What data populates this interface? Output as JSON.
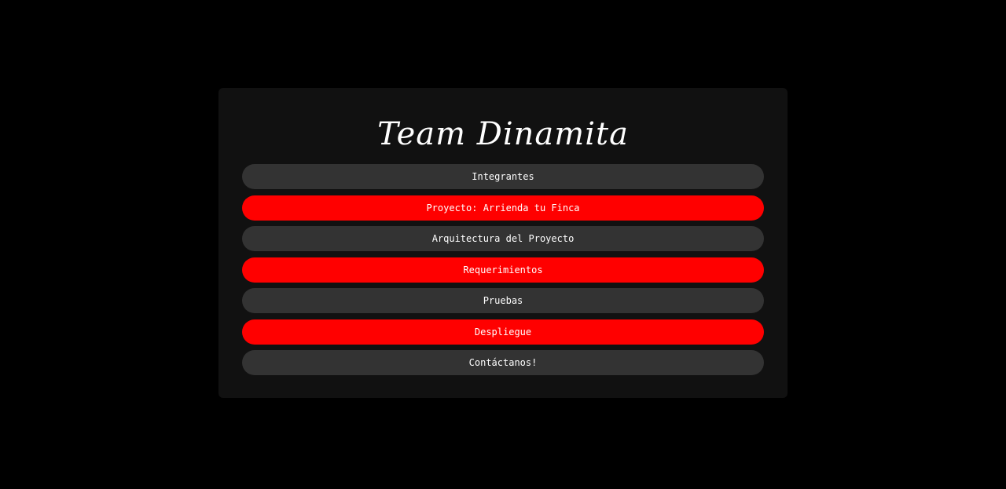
{
  "page": {
    "background_color": "#000000",
    "card_color": "#111111"
  },
  "header": {
    "title": "Team Dinamita"
  },
  "menu": {
    "colors": {
      "dark": "#333333",
      "red": "#ff0000",
      "text": "#ffffff"
    },
    "items": [
      {
        "label": "Integrantes",
        "style": "dark"
      },
      {
        "label": "Proyecto: Arrienda tu Finca",
        "style": "red"
      },
      {
        "label": "Arquitectura del Proyecto",
        "style": "dark"
      },
      {
        "label": "Requerimientos",
        "style": "red"
      },
      {
        "label": "Pruebas",
        "style": "dark"
      },
      {
        "label": "Despliegue",
        "style": "red"
      },
      {
        "label": "Contáctanos!",
        "style": "dark"
      }
    ]
  }
}
